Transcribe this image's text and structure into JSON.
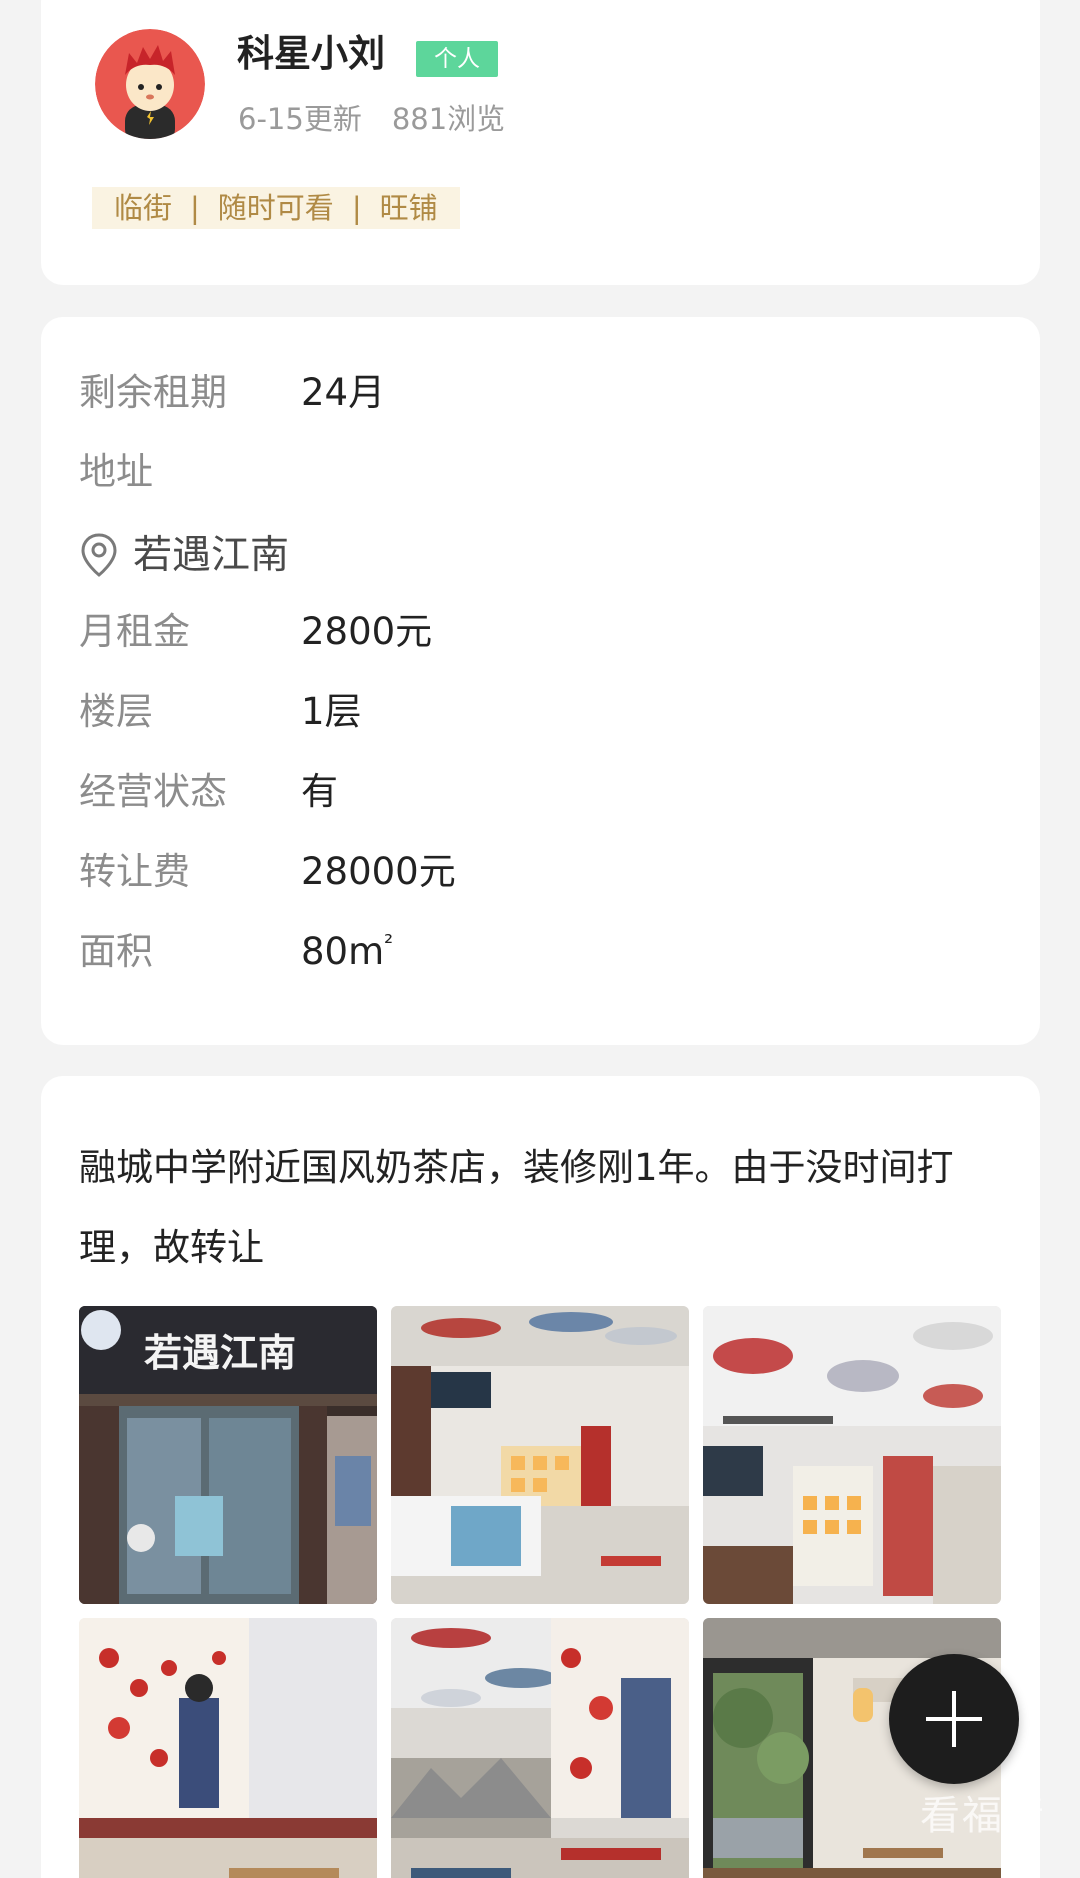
{
  "user": {
    "name": "科星小刘",
    "badge": "个人",
    "updated": "6-15更新",
    "views": "881浏览",
    "tags": [
      "临街",
      "随时可看",
      "旺铺"
    ]
  },
  "info": {
    "remaining_lease": {
      "label": "剩余租期",
      "value": "24月"
    },
    "address_label": "地址",
    "address": "若遇江南",
    "rent": {
      "label": "月租金",
      "value": "2800元"
    },
    "floor": {
      "label": "楼层",
      "value": "1层"
    },
    "status": {
      "label": "经营状态",
      "value": "有"
    },
    "transfer_fee": {
      "label": "转让费",
      "value": "28000元"
    },
    "area": {
      "label": "面积",
      "value": "80m",
      "unit_sup": "²"
    }
  },
  "description": {
    "text": "融城中学附近国风奶茶店，装修刚1年。由于没时间打理，故转让",
    "storefront_sign": "若遇江南"
  },
  "photos": [
    {
      "name": "storefront"
    },
    {
      "name": "interior-counter"
    },
    {
      "name": "interior-wall"
    },
    {
      "name": "interior-mural"
    },
    {
      "name": "interior-seating"
    },
    {
      "name": "interior-window"
    }
  ],
  "fab": {
    "icon": "plus-icon"
  },
  "watermark": "看福清",
  "colors": {
    "badge": "#5dd69b",
    "tag_bg": "#faf3e2",
    "tag_text": "#b08a45",
    "fab": "#1d1d1d"
  }
}
